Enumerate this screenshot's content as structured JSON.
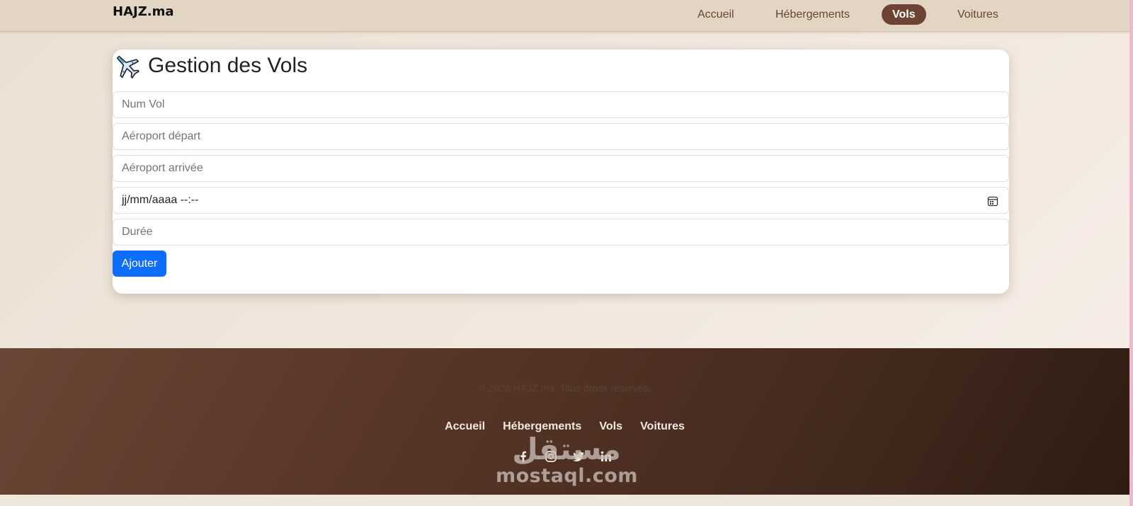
{
  "nav": {
    "brand": "HAJZ.ma",
    "links": [
      {
        "label": "Accueil",
        "active": false
      },
      {
        "label": "Hébergements",
        "active": false
      },
      {
        "label": "Vols",
        "active": true
      },
      {
        "label": "Voitures",
        "active": false
      }
    ]
  },
  "card": {
    "icon": "airplane-icon",
    "title": "Gestion des Vols",
    "fields": {
      "num_vol_placeholder": "Num Vol",
      "aeroport_depart_placeholder": "Aéroport départ",
      "aeroport_arrivee_placeholder": "Aéroport arrivée",
      "datetime_value": "jj/mm/aaaa --:--",
      "duree_placeholder": "Durée"
    },
    "submit_label": "Ajouter"
  },
  "footer": {
    "copyright": "© 2026 HAJZ.ma. Tous droits réservés.",
    "links": [
      "Accueil",
      "Hébergements",
      "Vols",
      "Voitures"
    ],
    "socials": [
      "facebook-icon",
      "instagram-icon",
      "twitter-icon",
      "linkedin-icon"
    ]
  },
  "watermark": {
    "arabic": "مستقل",
    "latin": "mostaql.com"
  },
  "colors": {
    "nav_bg": "#e2d5c4",
    "active_pill": "#6e4333",
    "primary_button": "#0d6efd",
    "footer_start": "#6b4536",
    "footer_end": "#2e1c12"
  }
}
